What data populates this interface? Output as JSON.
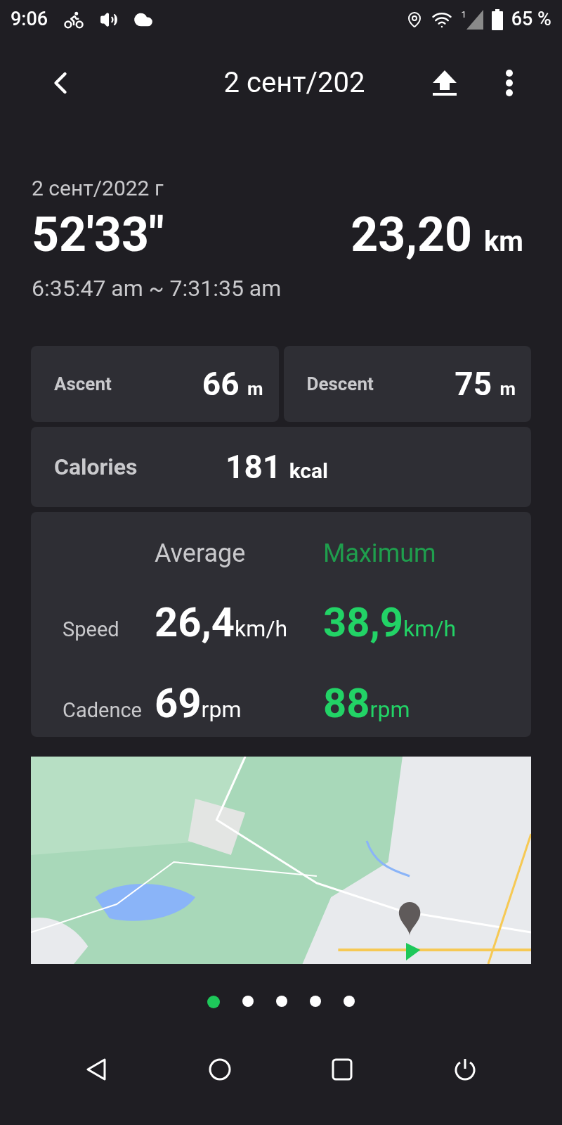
{
  "status_bar": {
    "time": "9:06",
    "sim_label": "1",
    "battery": "65 %"
  },
  "header": {
    "title": "2 сент/202"
  },
  "summary": {
    "date": "2 сент/2022 г",
    "duration": "52'33\"",
    "distance": "23,20",
    "distance_unit": "km",
    "time_range": "6:35:47 am ~ 7:31:35 am"
  },
  "elevation": [
    {
      "label": "Ascent",
      "value": "66",
      "unit": "m"
    },
    {
      "label": "Descent",
      "value": "75",
      "unit": "m"
    }
  ],
  "calories": {
    "label": "Calories",
    "value": "181",
    "unit": "kcal"
  },
  "stats": {
    "average_label": "Average",
    "maximum_label": "Maximum",
    "rows": [
      {
        "label": "Speed",
        "average": "26,4",
        "average_unit": "km/h",
        "maximum": "38,9",
        "maximum_unit": "km/h"
      },
      {
        "label": "Cadence",
        "average": "69",
        "average_unit": "rpm",
        "maximum": "88",
        "maximum_unit": "rpm"
      }
    ]
  },
  "pages": [
    {
      "selected": true
    },
    {
      "selected": false
    },
    {
      "selected": false
    },
    {
      "selected": false
    },
    {
      "selected": false
    }
  ]
}
